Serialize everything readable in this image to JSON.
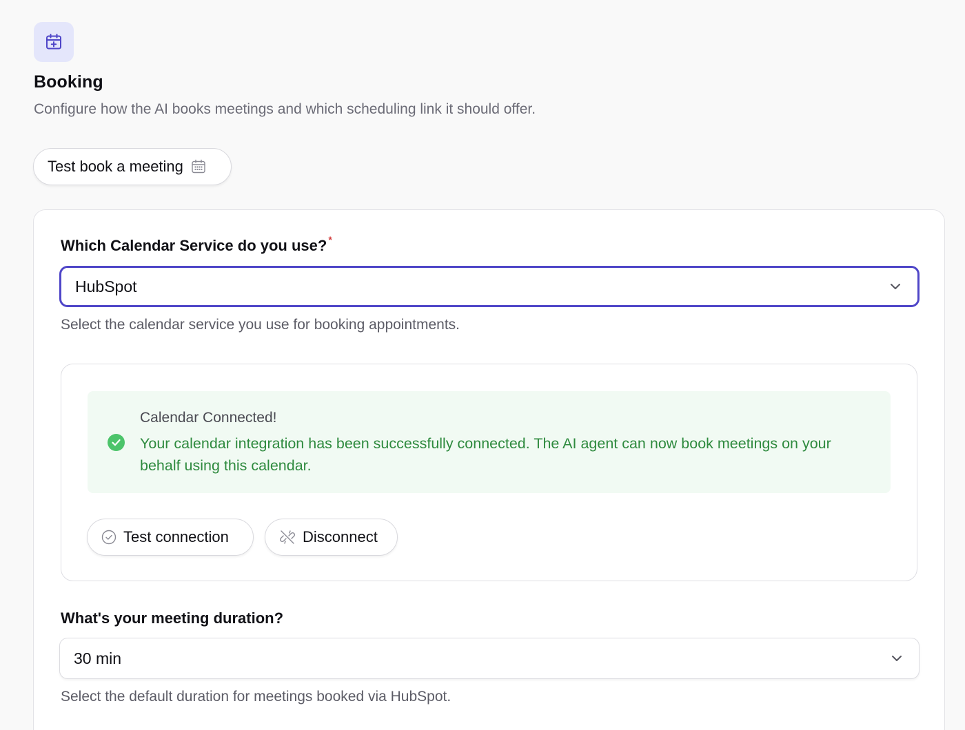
{
  "header": {
    "icon": "calendar-plus-icon",
    "title": "Booking",
    "subtitle": "Configure how the AI books meetings and which scheduling link it should offer."
  },
  "test_book_button": {
    "label": "Test book a meeting",
    "icon": "calendar-grid-icon"
  },
  "calendar_service": {
    "label": "Which Calendar Service do you use?",
    "required_marker": "*",
    "selected_value": "HubSpot",
    "helper": "Select the calendar service you use for booking appointments."
  },
  "connection": {
    "status_icon": "check-circle-icon",
    "title": "Calendar Connected!",
    "message": "Your calendar integration has been successfully connected. The AI agent can now book meetings on your behalf using this calendar.",
    "test_button_label": "Test connection",
    "disconnect_button_label": "Disconnect"
  },
  "meeting_duration": {
    "label": "What's your meeting duration?",
    "selected_value": "30 min",
    "helper": "Select the default duration for meetings booked via HubSpot."
  },
  "colors": {
    "accent": "#4f46c8",
    "success": "#2e8a3e",
    "success_bg": "#f1faf3",
    "icon_bg": "#e4e6fb"
  }
}
